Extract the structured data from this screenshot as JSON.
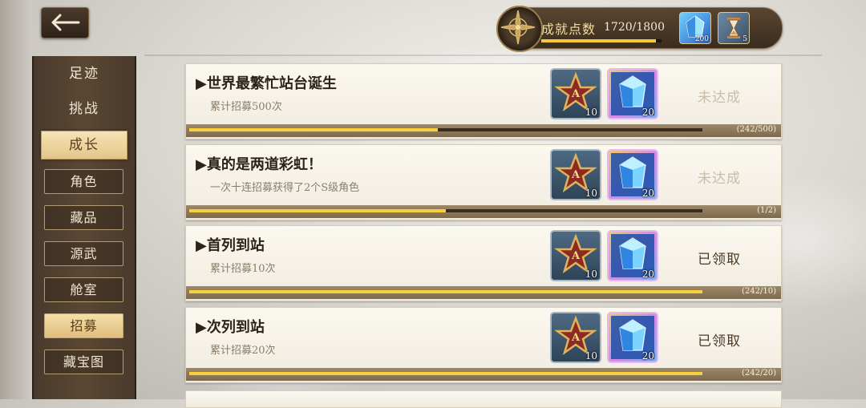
{
  "header": {
    "back_icon": "arrow-left-icon",
    "points_label": "成就点数",
    "points_value": "1720/1800",
    "points_progress": 0.956,
    "resources": [
      {
        "icon": "blue-crystal-icon",
        "count": "200"
      },
      {
        "icon": "hourglass-icon",
        "count": "5"
      }
    ]
  },
  "sidebar": {
    "categories": [
      {
        "label": "足迹"
      },
      {
        "label": "挑战"
      },
      {
        "label": "成长",
        "active": true
      }
    ],
    "subcategories": [
      {
        "label": "角色"
      },
      {
        "label": "藏品"
      },
      {
        "label": "源武"
      },
      {
        "label": "舱室"
      },
      {
        "label": "招募",
        "active": true
      },
      {
        "label": "藏宝图"
      }
    ]
  },
  "achievements": [
    {
      "title": "▶世界最繁忙站台诞生",
      "desc": "累计招募500次",
      "status": "未达成",
      "state": "pending",
      "progress_text": "(242/500)",
      "progress": 0.484,
      "rewards": [
        {
          "icon": "a-rank-star-icon",
          "qty": "10"
        },
        {
          "icon": "crystal-icon",
          "qty": "20"
        }
      ]
    },
    {
      "title": "▶真的是两道彩虹！",
      "desc": "一次十连招募获得了2个S级角色",
      "status": "未达成",
      "state": "pending",
      "progress_text": "(1/2)",
      "progress": 0.5,
      "rewards": [
        {
          "icon": "a-rank-star-icon",
          "qty": "10"
        },
        {
          "icon": "crystal-icon",
          "qty": "20"
        }
      ]
    },
    {
      "title": "▶首列到站",
      "desc": "累计招募10次",
      "status": "已领取",
      "state": "claimed",
      "progress_text": "(242/10)",
      "progress": 1.0,
      "rewards": [
        {
          "icon": "a-rank-star-icon",
          "qty": "10"
        },
        {
          "icon": "crystal-icon",
          "qty": "20"
        }
      ]
    },
    {
      "title": "▶次列到站",
      "desc": "累计招募20次",
      "status": "已领取",
      "state": "claimed",
      "progress_text": "(242/20)",
      "progress": 1.0,
      "rewards": [
        {
          "icon": "a-rank-star-icon",
          "qty": "10"
        },
        {
          "icon": "crystal-icon",
          "qty": "20"
        }
      ]
    }
  ],
  "colors": {
    "accent": "#f6d03e",
    "sidebar": "#4a3a2c",
    "card": "#f7f2e8"
  }
}
